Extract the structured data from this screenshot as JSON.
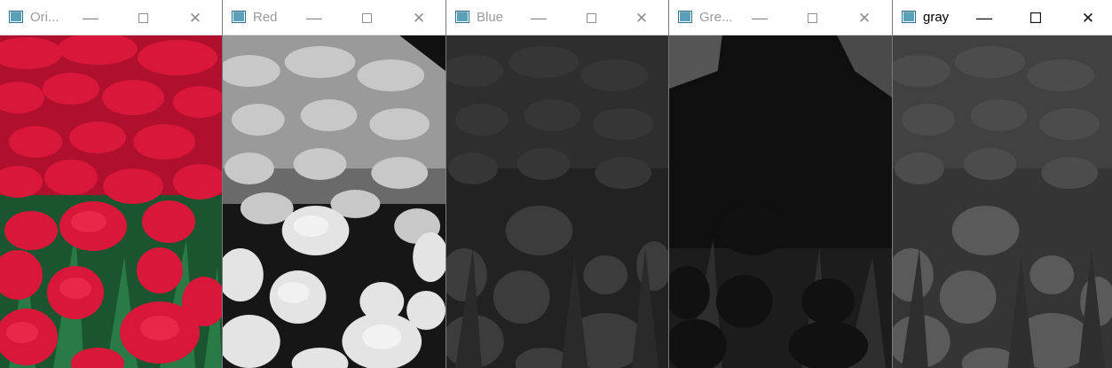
{
  "windows": [
    {
      "id": "original",
      "title": "Ori...",
      "channel": "original",
      "active": false
    },
    {
      "id": "red",
      "title": "Red",
      "channel": "red",
      "active": false
    },
    {
      "id": "blue",
      "title": "Blue",
      "channel": "blue",
      "active": false
    },
    {
      "id": "green",
      "title": "Gre...",
      "channel": "green",
      "active": false
    },
    {
      "id": "gray",
      "title": "gray",
      "channel": "gray",
      "active": true
    }
  ],
  "controls": {
    "minimize": "—",
    "maximize": "☐",
    "close": "✕"
  },
  "icons": {
    "app": "opencv-window-icon",
    "image": "tulip-field-image"
  },
  "colors": {
    "original_bg": "#b0102a",
    "original_petal": "#d8173b",
    "original_leaf": "#1e6a3a",
    "red_bg": "#8a8a8a",
    "red_petal": "#d9d9d9",
    "blue_bg": "#262626",
    "blue_petal": "#3a3a3a",
    "green_bg": "#141414",
    "green_petal": "#1e1e1e",
    "gray_bg": "#3a3a3a",
    "gray_petal": "#5a5a5a"
  }
}
